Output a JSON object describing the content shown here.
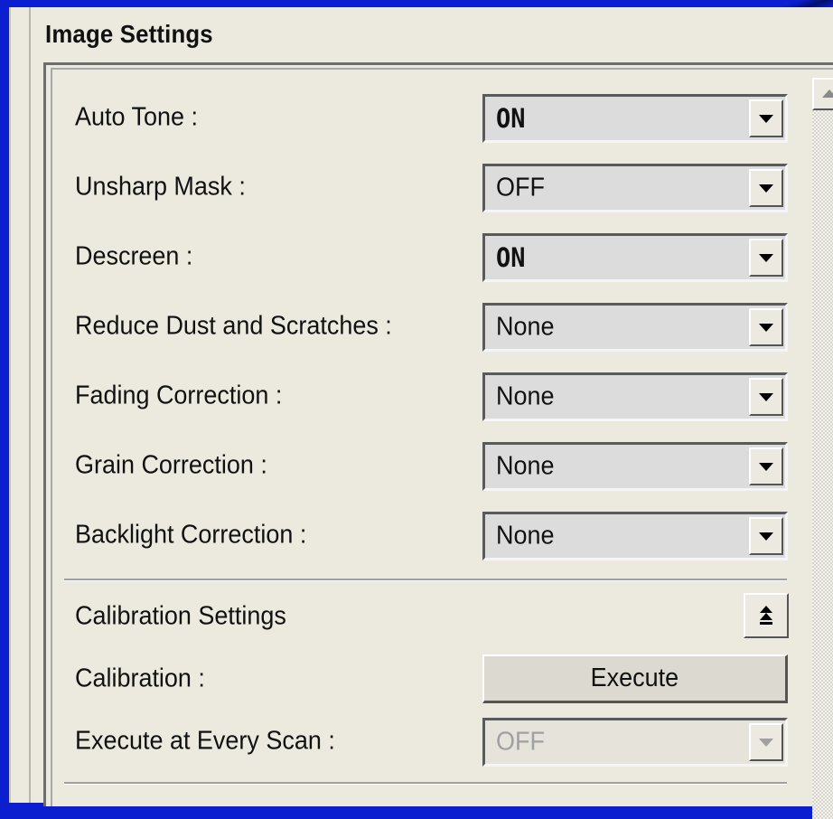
{
  "panel": {
    "title": "Image Settings"
  },
  "settings": [
    {
      "label": "Auto Tone :",
      "value": "ON",
      "emphasis": true
    },
    {
      "label": "Unsharp Mask :",
      "value": "OFF",
      "emphasis": false
    },
    {
      "label": "Descreen :",
      "value": "ON",
      "emphasis": true
    },
    {
      "label": "Reduce Dust and Scratches :",
      "value": "None",
      "emphasis": false
    },
    {
      "label": "Fading Correction :",
      "value": "None",
      "emphasis": false
    },
    {
      "label": "Grain Correction :",
      "value": "None",
      "emphasis": false
    },
    {
      "label": "Backlight Correction :",
      "value": "None",
      "emphasis": false
    }
  ],
  "calibration": {
    "section_title": "Calibration Settings",
    "calibration_label": "Calibration :",
    "execute_button": "Execute",
    "every_scan_label": "Execute at Every Scan :",
    "every_scan_value": "OFF",
    "every_scan_disabled": true
  },
  "colors": {
    "desktop": "#0c1fd0",
    "panel_bg": "#eceade",
    "select_bg": "#dcdcdc"
  }
}
